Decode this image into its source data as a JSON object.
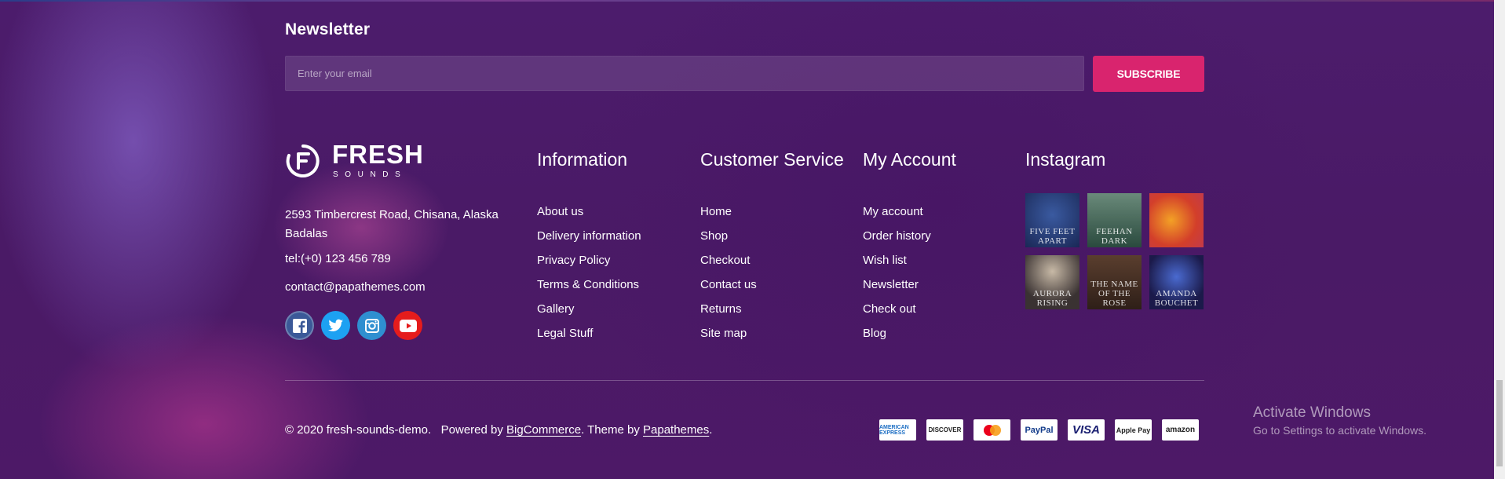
{
  "newsletter": {
    "title": "Newsletter",
    "placeholder": "Enter your email",
    "button_label": "SUBSCRIBE"
  },
  "brand": {
    "logo_word": "FRESH",
    "logo_sub": "SOUNDS"
  },
  "contact": {
    "address": "2593 Timbercrest Road, Chisana, Alaska Badalas",
    "phone": "tel:(+0) 123 456 789",
    "email": "contact@papathemes.com"
  },
  "social": [
    "facebook-icon",
    "twitter-icon",
    "instagram-icon",
    "youtube-icon"
  ],
  "columns": {
    "information": {
      "title": "Information",
      "items": [
        "About us",
        "Delivery information",
        "Privacy Policy",
        "Terms & Conditions",
        "Gallery",
        "Legal Stuff"
      ]
    },
    "customer_service": {
      "title": "Customer Service",
      "items": [
        "Home",
        "Shop",
        "Checkout",
        "Contact us",
        "Returns",
        "Site map"
      ]
    },
    "my_account": {
      "title": "My Account",
      "items": [
        "My account",
        "Order history",
        "Wish list",
        "Newsletter",
        "Check out",
        "Blog"
      ]
    },
    "instagram": {
      "title": "Instagram",
      "images": [
        {
          "text": "FIVE FEET APART"
        },
        {
          "text": "FEEHAN DARK"
        },
        {
          "text": ""
        },
        {
          "text": "AURORA RISING"
        },
        {
          "text": "THE NAME OF THE ROSE"
        },
        {
          "text": "AMANDA BOUCHET"
        }
      ]
    }
  },
  "copyright": {
    "prefix": "© 2020 fresh-sounds-demo.   Powered by ",
    "bigcommerce": "BigCommerce",
    "middle": ". Theme by ",
    "papathemes": "Papathemes",
    "suffix": "."
  },
  "payments": [
    "AMERICAN EXPRESS",
    "DISCOVER",
    "mastercard",
    "PayPal",
    "VISA",
    "Apple Pay",
    "amazon"
  ],
  "windows_notice": {
    "title": "Activate Windows",
    "subtitle": "Go to Settings to activate Windows."
  }
}
